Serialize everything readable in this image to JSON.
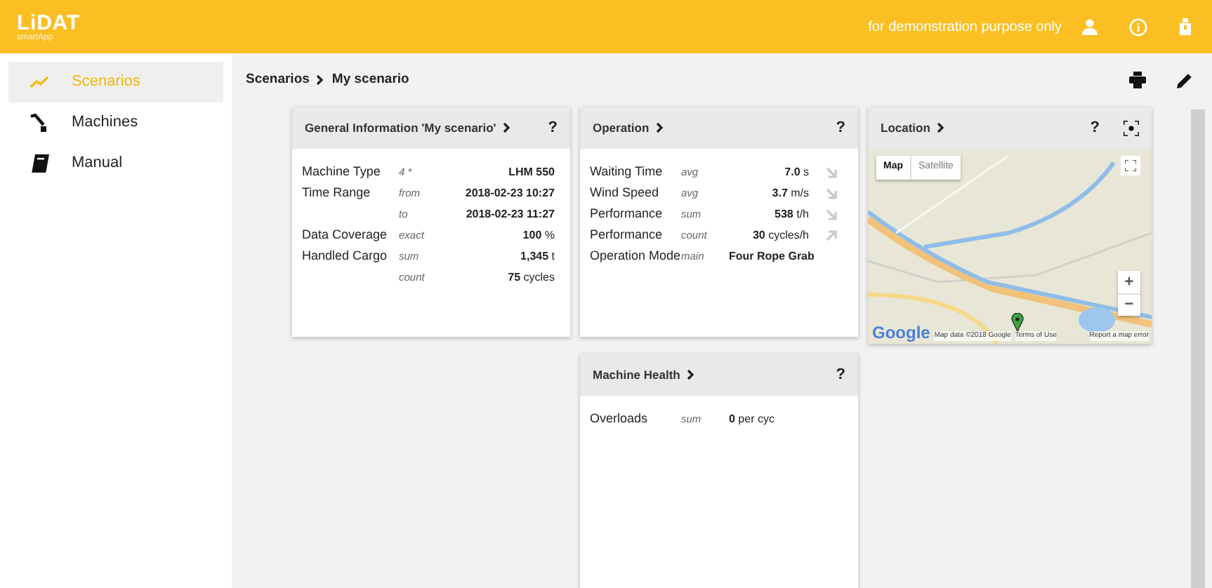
{
  "header": {
    "logo": "LiDAT",
    "logo_sub": "smartApp",
    "notice": "for demonstration purpose only"
  },
  "sidebar": {
    "items": [
      {
        "label": "Scenarios",
        "selected": true
      },
      {
        "label": "Machines",
        "selected": false
      },
      {
        "label": "Manual",
        "selected": false
      }
    ]
  },
  "breadcrumb": [
    "Scenarios",
    "My scenario"
  ],
  "cards": [
    {
      "title": "General Information 'My scenario'",
      "help": "?",
      "rows": [
        {
          "label": "Machine Type",
          "qualifier": "4 *",
          "value": "LHM 550",
          "unit": ""
        },
        {
          "label": "Time Range",
          "qualifier": "from",
          "value": "2018-02-23 10:27",
          "unit": ""
        },
        {
          "label": "",
          "qualifier": "to",
          "value": "2018-02-23 11:27",
          "unit": ""
        },
        {
          "label": "Data Coverage",
          "qualifier": "exact",
          "value": "100",
          "unit": "%"
        },
        {
          "label": "Handled Cargo",
          "qualifier": "sum",
          "value": "1,345",
          "unit": "t"
        },
        {
          "label": "",
          "qualifier": "count",
          "value": "75",
          "unit": "cycles"
        }
      ]
    },
    {
      "title": "Operation",
      "help": "?",
      "rows": [
        {
          "label": "Waiting Time",
          "qualifier": "avg",
          "value": "7.0",
          "unit": "s",
          "kind": "falling"
        },
        {
          "label": "Wind Speed",
          "qualifier": "avg",
          "value": "3.7",
          "unit": "m/s",
          "kind": "falling"
        },
        {
          "label": "Performance",
          "qualifier": "sum",
          "value": "538",
          "unit": "t/h",
          "kind": "falling"
        },
        {
          "label": "Performance",
          "qualifier": "count",
          "value": "30",
          "unit": "cycles/h",
          "kind": "rising"
        },
        {
          "label": "Operation Mode",
          "qualifier": "main",
          "value": "Four Rope Grab",
          "unit": "",
          "kind": "text"
        }
      ]
    },
    {
      "title": "Location",
      "help": "?",
      "kind": "map",
      "map": {
        "buttons": [
          {
            "label": "Map",
            "selected": true
          },
          {
            "label": "Satellite",
            "selected": false
          }
        ],
        "zoom_in": "+",
        "zoom_out": "−",
        "logo": "Google",
        "attribution": "Map data ©2018 Google",
        "terms": "Terms of Use",
        "report": "Report a map error"
      }
    },
    {
      "title": "Machine Health",
      "help": "?",
      "rows": [
        {
          "label": "Overloads",
          "qualifier": "sum",
          "value": "0",
          "unit": "per cyc",
          "kind": "text"
        }
      ]
    }
  ]
}
